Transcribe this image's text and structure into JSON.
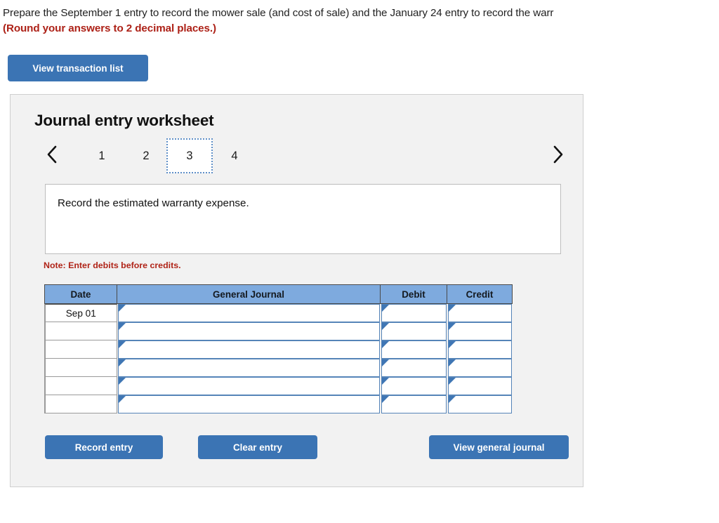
{
  "prompt": {
    "line1": "Prepare the September 1 entry to record the mower sale (and cost of sale) and the January 24 entry to record the warr",
    "line2": "(Round your answers to 2 decimal places.)"
  },
  "toolbar": {
    "view_transaction_list_label": "View transaction list"
  },
  "worksheet": {
    "title": "Journal entry worksheet",
    "prev_arrow_icon": "chevron-left-icon",
    "next_arrow_icon": "chevron-right-icon",
    "tabs": [
      {
        "label": "1",
        "active": false
      },
      {
        "label": "2",
        "active": false
      },
      {
        "label": "3",
        "active": true
      },
      {
        "label": "4",
        "active": false
      }
    ],
    "instruction": "Record the estimated warranty expense.",
    "note": "Note: Enter debits before credits."
  },
  "journal_table": {
    "headers": [
      "Date",
      "General Journal",
      "Debit",
      "Credit"
    ],
    "rows": [
      {
        "date": "Sep 01",
        "general_journal": "",
        "debit": "",
        "credit": ""
      },
      {
        "date": "",
        "general_journal": "",
        "debit": "",
        "credit": ""
      },
      {
        "date": "",
        "general_journal": "",
        "debit": "",
        "credit": ""
      },
      {
        "date": "",
        "general_journal": "",
        "debit": "",
        "credit": ""
      },
      {
        "date": "",
        "general_journal": "",
        "debit": "",
        "credit": ""
      },
      {
        "date": "",
        "general_journal": "",
        "debit": "",
        "credit": ""
      }
    ]
  },
  "actions": {
    "record_entry_label": "Record entry",
    "clear_entry_label": "Clear entry",
    "view_general_journal_label": "View general journal"
  },
  "colors": {
    "button_blue": "#3b74b4",
    "table_header_blue": "#7eaade",
    "note_red": "#b02418",
    "prompt_red": "#ad2117",
    "panel_bg": "#f2f2f2",
    "tab_active_border": "#5f8fc7"
  }
}
